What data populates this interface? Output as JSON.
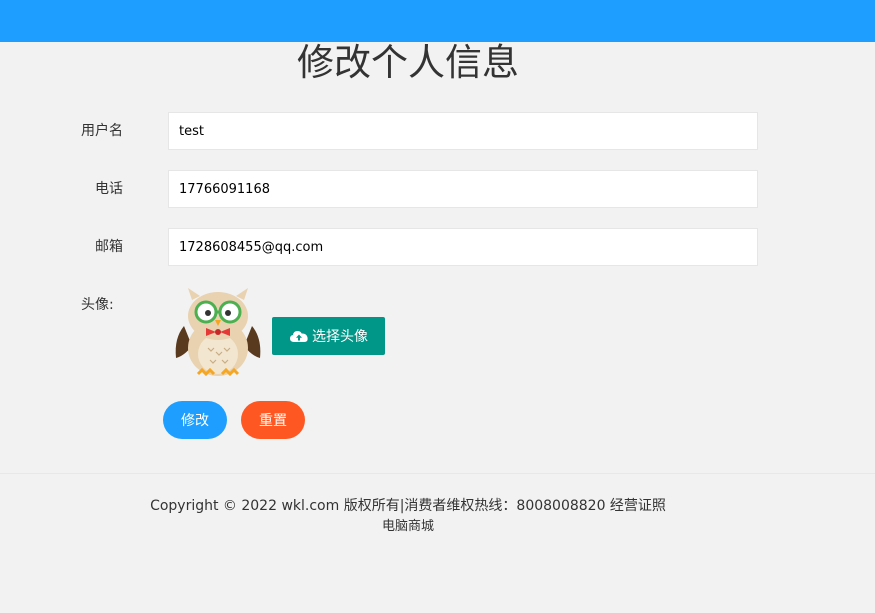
{
  "header": {
    "title": "修改个人信息",
    "accent_color": "#1e9fff"
  },
  "form": {
    "username": {
      "label": "用户名",
      "value": "test"
    },
    "phone": {
      "label": "电话",
      "value": "17766091168"
    },
    "email": {
      "label": "邮箱",
      "value": "1728608455@qq.com"
    },
    "avatar": {
      "label": "头像:",
      "upload_label": "选择头像",
      "upload_icon": "cloud-upload-icon",
      "upload_color": "#009688"
    }
  },
  "actions": {
    "submit_label": "修改",
    "submit_color": "#1e9fff",
    "reset_label": "重置",
    "reset_color": "#ff5722"
  },
  "footer": {
    "copyright": "Copyright © 2022 wkl.com 版权所有|消费者维权热线：8008008820 经营证照",
    "site_name": "电脑商城"
  }
}
